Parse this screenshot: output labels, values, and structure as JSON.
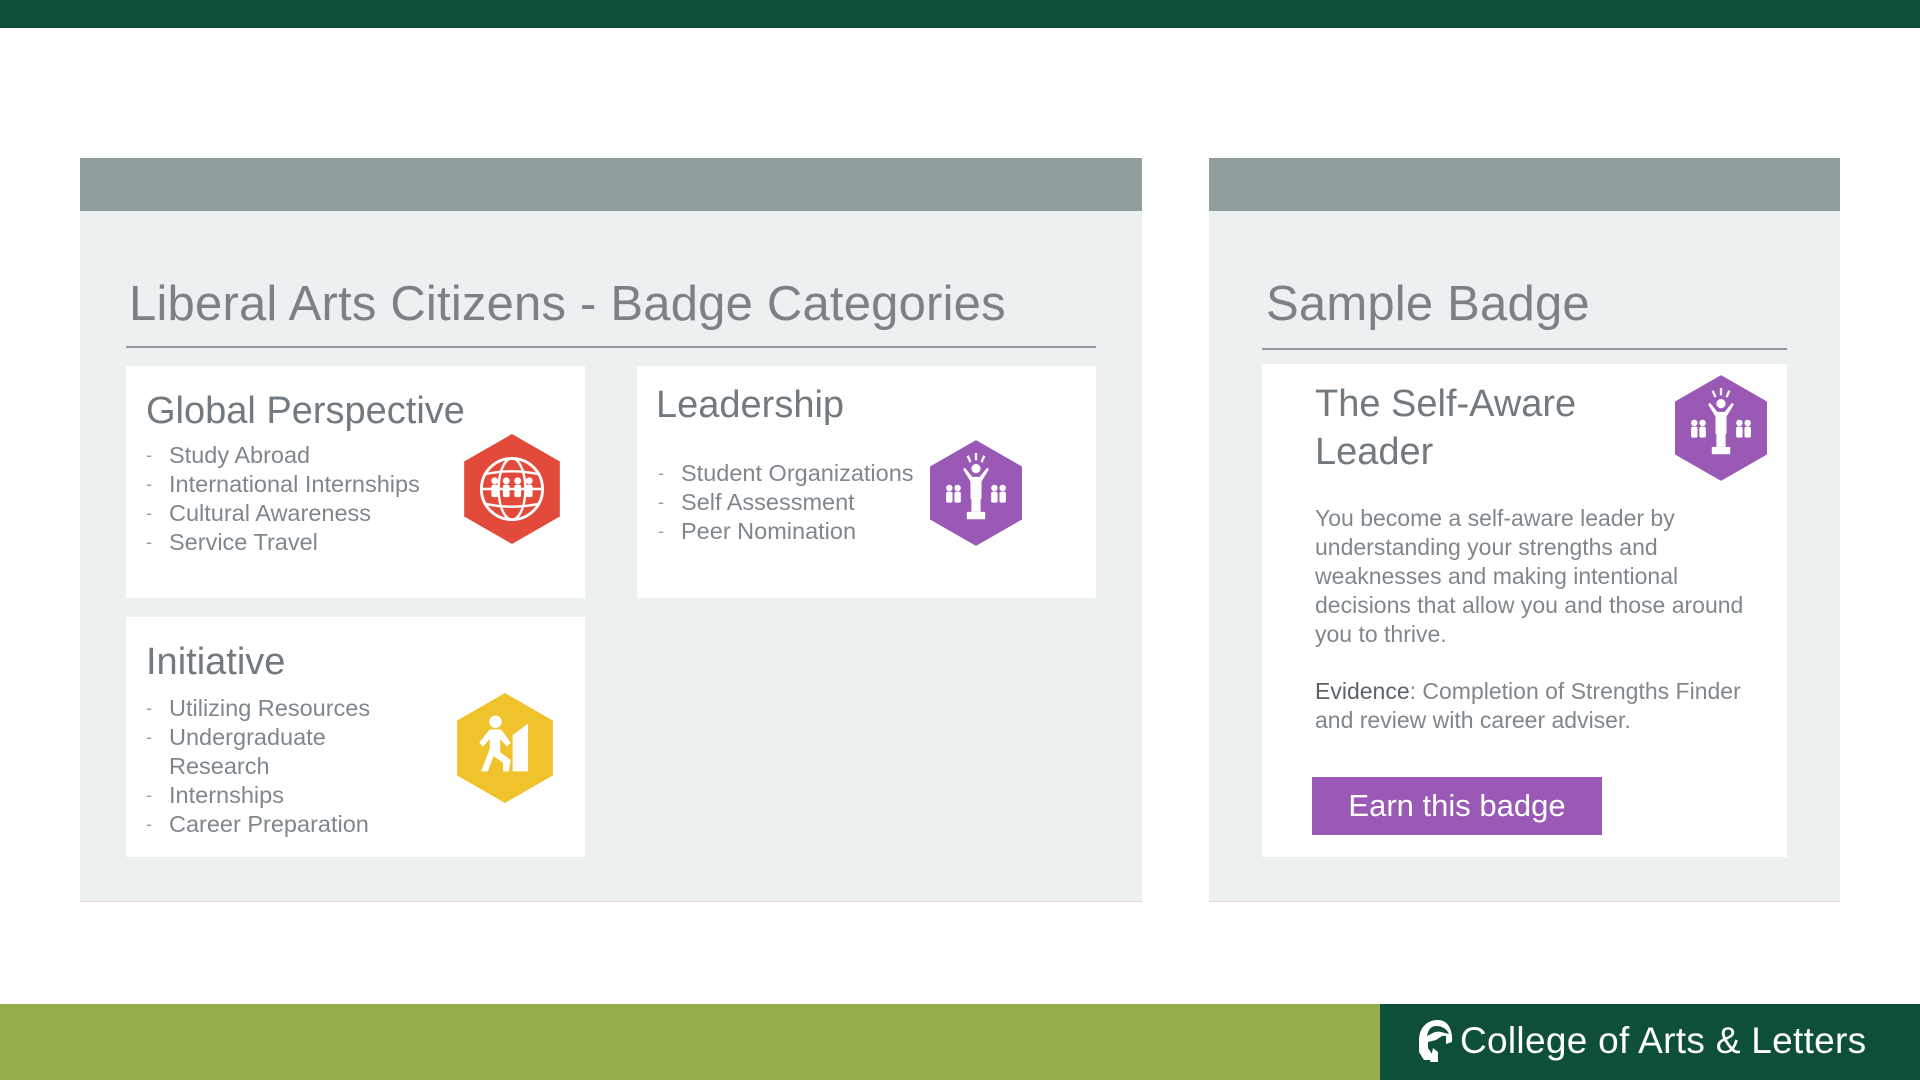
{
  "left_panel": {
    "title": "Liberal Arts Citizens - Badge Categories",
    "categories": [
      {
        "title": "Global Perspective",
        "items": [
          "Study Abroad",
          "International Internships",
          "Cultural Awareness",
          "Service Travel"
        ],
        "icon": "globe-people-icon",
        "color": "#e24b3b"
      },
      {
        "title": "Leadership",
        "items": [
          "Student Organizations",
          "Self Assessment",
          "Peer Nomination"
        ],
        "icon": "leader-trophy-icon",
        "color": "#9b59b6"
      },
      {
        "title": "Initiative",
        "items": [
          "Utilizing Resources",
          "Undergraduate Research",
          "Internships",
          "Career Preparation"
        ],
        "icon": "climbing-person-icon",
        "color": "#f0c22b"
      }
    ]
  },
  "right_panel": {
    "title": "Sample Badge",
    "badge": {
      "name_line1": "The Self-Aware",
      "name_line2": "Leader",
      "icon": "leader-trophy-icon",
      "color": "#9b59b6",
      "description": "You become a self-aware leader by understanding your strengths and weaknesses and making intentional decisions that allow you and those around you to thrive.",
      "evidence_label": "Evidence",
      "evidence_text": ": Completion of Strengths Finder and review with career adviser.",
      "button_label": "Earn this badge"
    }
  },
  "footer": {
    "college_name": "College of Arts & Letters",
    "logo": "spartan-helmet-icon",
    "green": "#94ae4a",
    "dark_green": "#0e4f3b"
  }
}
